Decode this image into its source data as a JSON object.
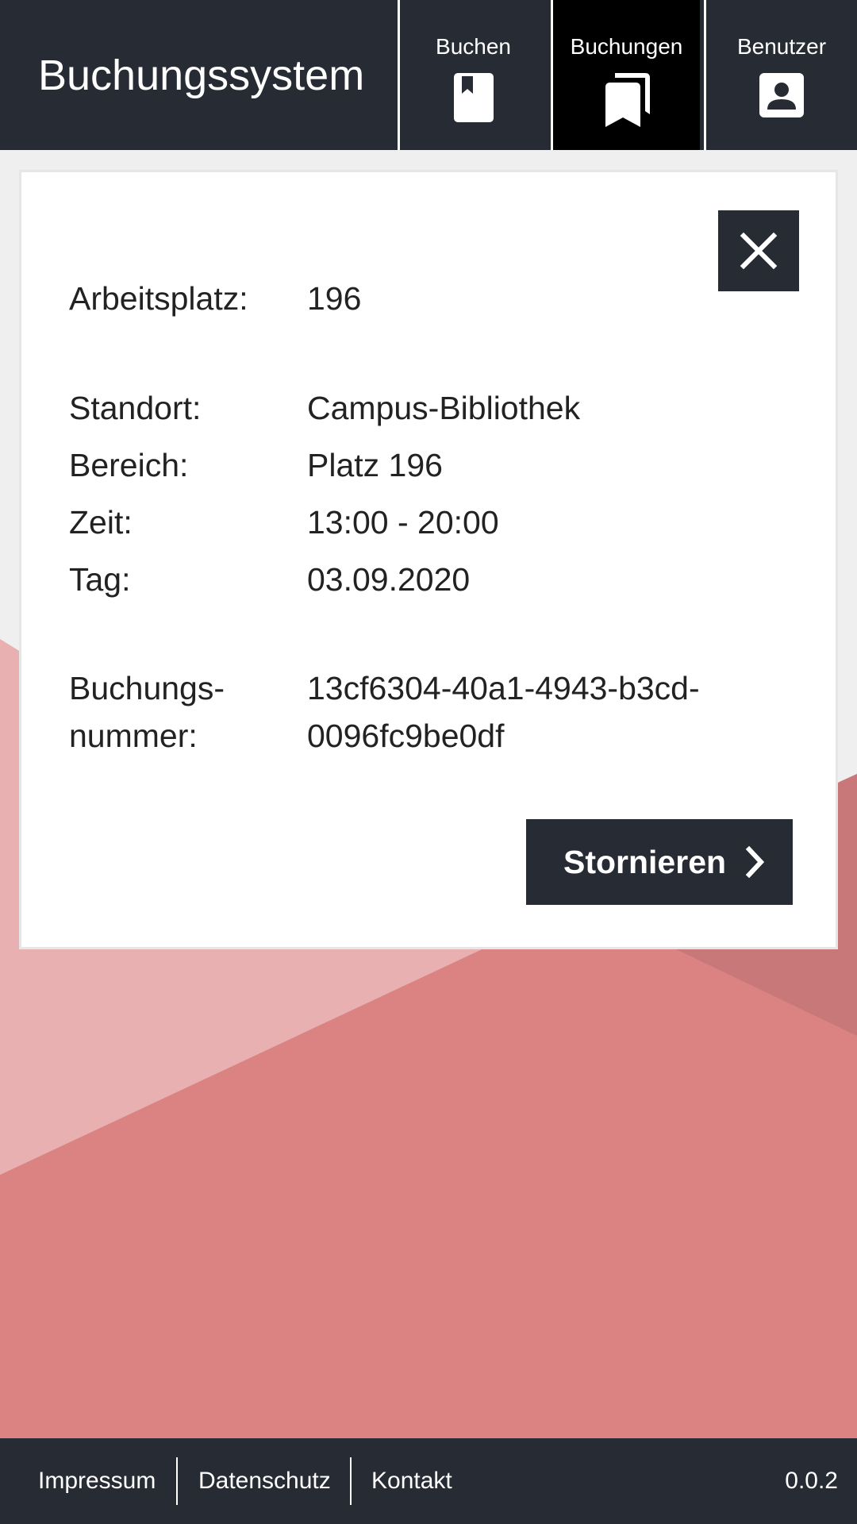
{
  "header": {
    "title": "Buchungssystem",
    "tabs": [
      {
        "label": "Buchen",
        "icon": "book-icon",
        "active": false
      },
      {
        "label": "Buchungen",
        "icon": "bookmarks-icon",
        "active": true
      },
      {
        "label": "Benutzer",
        "icon": "user-icon",
        "active": false
      }
    ]
  },
  "booking": {
    "workplace_label": "Arbeitsplatz:",
    "workplace_value": "196",
    "location_label": "Standort:",
    "location_value": "Campus-Bibliothek",
    "area_label": "Bereich:",
    "area_value": "Platz 196",
    "time_label": "Zeit:",
    "time_value": "13:00 - 20:00",
    "day_label": "Tag:",
    "day_value": "03.09.2020",
    "number_label_line1": "Buchungs-",
    "number_label_line2": "nummer:",
    "number_value_line1": "13cf6304-40a1-4943-b3cd-",
    "number_value_line2": "0096fc9be0df",
    "cancel_label": "Stornieren",
    "close_icon": "close-icon",
    "chevron_icon": "chevron-right-icon"
  },
  "footer": {
    "links": [
      "Impressum",
      "Datenschutz",
      "Kontakt"
    ],
    "version": "0.0.2"
  },
  "colors": {
    "dark": "#272b33",
    "active_tab": "#000000",
    "background": "#efefef",
    "shape_light": "#e8b0b0",
    "shape_mid": "#db8282",
    "shape_dark": "#c87878"
  }
}
